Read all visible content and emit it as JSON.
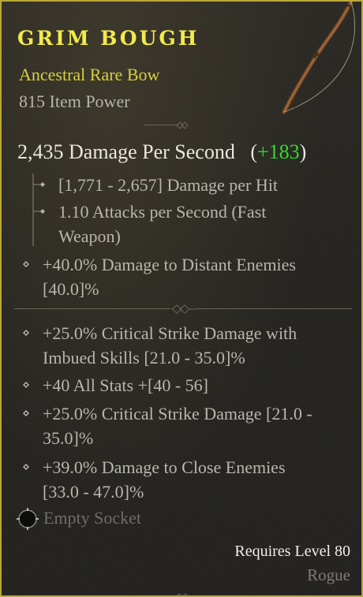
{
  "item": {
    "name": "GRIM BOUGH",
    "type": "Ancestral Rare Bow",
    "item_power": "815 Item Power",
    "accent_color": "#f2e94c",
    "border_color": "#b9a83a"
  },
  "weapon": {
    "dps": "2,435 Damage Per Second",
    "dps_delta_open": "(",
    "dps_delta": "+183",
    "dps_delta_close": ")",
    "delta_color": "#33d92e",
    "damage_per_hit": "[1,771 - 2,657] Damage per Hit",
    "attacks_line1": "1.10 Attacks per Second (Fast",
    "attacks_line2": "Weapon)",
    "implicit_line1": "+40.0% Damage to Distant Enemies",
    "implicit_line2": "[40.0]%"
  },
  "affixes": [
    {
      "line1": "+25.0% Critical Strike Damage with",
      "line2": "Imbued Skills [21.0 - 35.0]%"
    },
    {
      "line1": "+40 All Stats +[40 - 56]",
      "line2": ""
    },
    {
      "line1": "+25.0% Critical Strike Damage [21.0 -",
      "line2": "35.0]%"
    },
    {
      "line1": "+39.0% Damage to Close Enemies",
      "line2": "[33.0 - 47.0]%"
    }
  ],
  "socket": {
    "label": "Empty Socket",
    "icon": "socket-icon"
  },
  "requirements": {
    "level": "Requires Level 80",
    "class": "Rogue"
  }
}
